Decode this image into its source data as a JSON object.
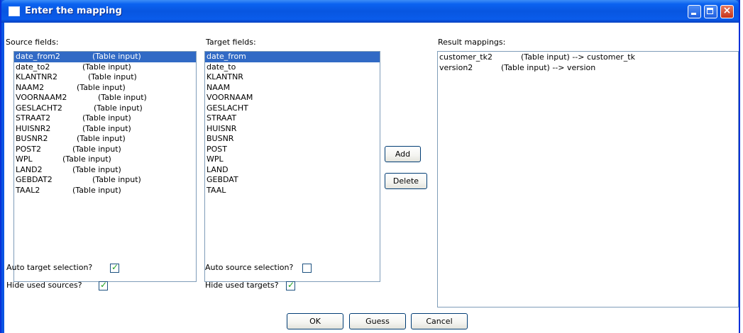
{
  "window": {
    "title": "Enter the mapping"
  },
  "source": {
    "label": "Source fields:",
    "items": [
      {
        "name": "date_from2",
        "origin": "(Table input)",
        "selected": true
      },
      {
        "name": "date_to2",
        "origin": "(Table input)"
      },
      {
        "name": "KLANTNR2",
        "origin": "(Table input)"
      },
      {
        "name": "NAAM2",
        "origin": "(Table input)"
      },
      {
        "name": "VOORNAAM2",
        "origin": "(Table input)"
      },
      {
        "name": "GESLACHT2",
        "origin": "(Table input)"
      },
      {
        "name": "STRAAT2",
        "origin": "(Table input)"
      },
      {
        "name": "HUISNR2",
        "origin": "(Table input)"
      },
      {
        "name": "BUSNR2",
        "origin": "(Table input)"
      },
      {
        "name": "POST2",
        "origin": "(Table input)"
      },
      {
        "name": "WPL",
        "origin": "(Table input)"
      },
      {
        "name": "LAND2",
        "origin": "(Table input)"
      },
      {
        "name": "GEBDAT2",
        "origin": "(Table input)"
      },
      {
        "name": "TAAL2",
        "origin": "(Table input)"
      }
    ],
    "auto_label": "Auto target selection?",
    "auto_checked": true,
    "hide_label": "Hide used sources?",
    "hide_checked": true
  },
  "target": {
    "label": "Target fields:",
    "items": [
      "date_from",
      "date_to",
      "KLANTNR",
      "NAAM",
      "VOORNAAM",
      "GESLACHT",
      "STRAAT",
      "HUISNR",
      "BUSNR",
      "POST",
      "WPL",
      "LAND",
      "GEBDAT",
      "TAAL"
    ],
    "auto_label": "Auto source selection?",
    "auto_checked": false,
    "hide_label": "Hide used targets?",
    "hide_checked": true
  },
  "actions": {
    "add": "Add",
    "delete": "Delete"
  },
  "result": {
    "label": "Result mappings:",
    "items": [
      {
        "source": "customer_tk2",
        "mapping": "(Table input) --> customer_tk"
      },
      {
        "source": "version2",
        "mapping": "(Table input) --> version"
      }
    ]
  },
  "footer": {
    "ok": "OK",
    "guess": "Guess",
    "cancel": "Cancel"
  },
  "colors": {
    "title_bar": "#0a54e3",
    "selection": "#316ac5",
    "check": "#21a121",
    "close_button": "#c7341a"
  },
  "icons": {
    "window": "window-icon",
    "check": "checkmark-icon",
    "close": "close-icon"
  }
}
